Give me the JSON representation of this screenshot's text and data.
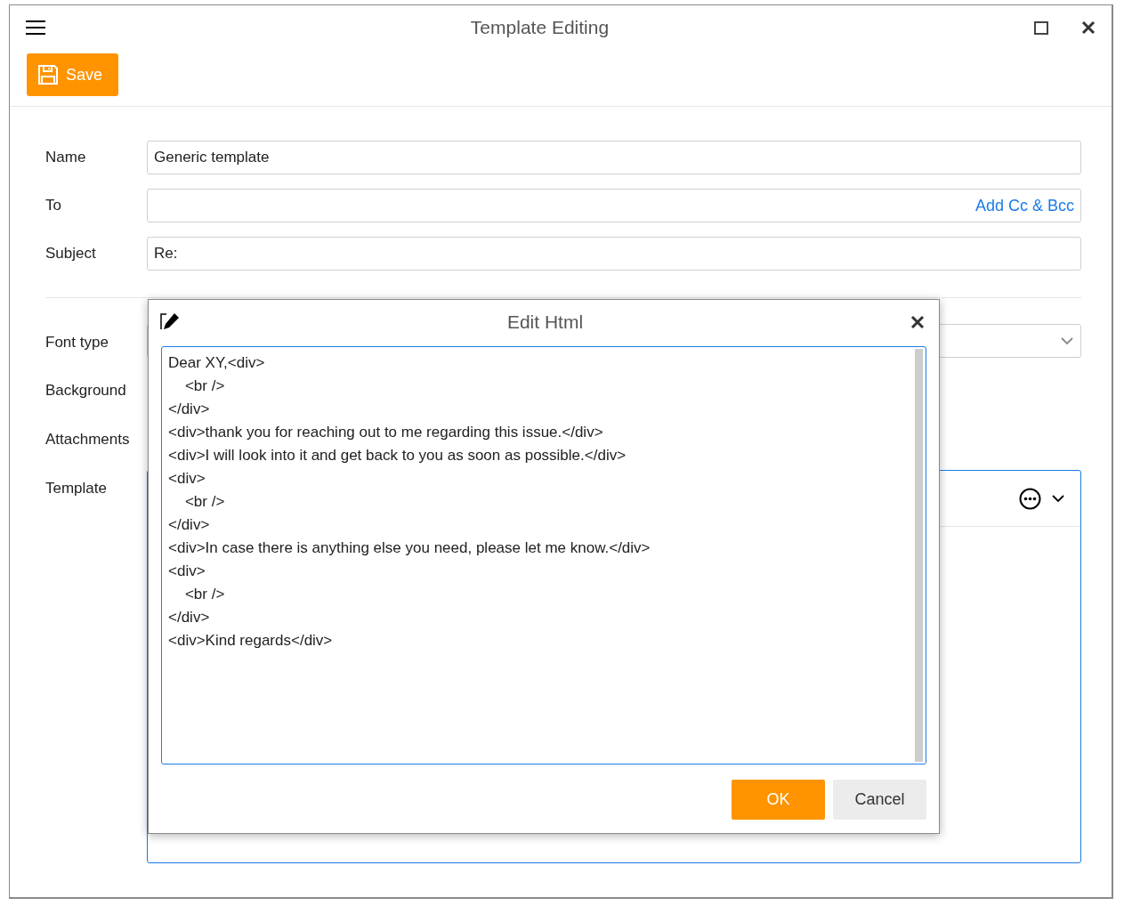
{
  "window": {
    "title": "Template Editing"
  },
  "toolbar": {
    "save_label": "Save"
  },
  "form": {
    "fields": [
      {
        "label": "Name",
        "value": "Generic template"
      },
      {
        "label": "To",
        "link": "Add Cc & Bcc"
      },
      {
        "label": "Subject",
        "value": "Re:"
      }
    ],
    "settings": [
      {
        "label": "Font type",
        "kind": "dropdown"
      },
      {
        "label": "Background",
        "kind": "blank"
      },
      {
        "label": "Attachments",
        "kind": "blank"
      },
      {
        "label": "Template",
        "kind": "editor"
      }
    ]
  },
  "dialog": {
    "title": "Edit Html",
    "code_lines": [
      "Dear XY,<div>",
      "    <br />",
      "</div>",
      "<div>thank you for reaching out to me regarding this issue.</div>",
      "<div>I will look into it and get back to you as soon as possible.</div>",
      "<div>",
      "    <br />",
      "</div>",
      "<div>In case there is anything else you need, please let me know.</div>",
      "<div>",
      "    <br />",
      "</div>",
      "<div>Kind regards</div>"
    ],
    "buttons": [
      {
        "label": "OK",
        "kind": "primary"
      },
      {
        "label": "Cancel",
        "kind": "secondary"
      }
    ]
  }
}
